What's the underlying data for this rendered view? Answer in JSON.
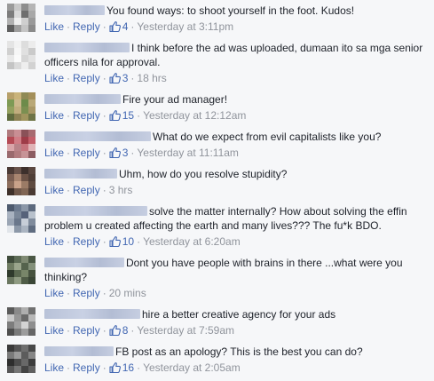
{
  "labels": {
    "like": "Like",
    "reply": "Reply",
    "sep": "·"
  },
  "colors": {
    "link": "#4267b2",
    "meta": "#90949c",
    "text": "#1d2129",
    "background": "#f6f7f9"
  },
  "comments": [
    {
      "text": "You found ways: to shoot yourself in the foot. Kudos!",
      "likes": "4",
      "time": "Yesterday at 3:11pm",
      "avatar": [
        "#9a9a9a",
        "#c8c8c8",
        "#8e8e8e",
        "#b5b5b5",
        "#7c7c7c",
        "#d9d9d9",
        "#6e6e6e",
        "#a8a8a8",
        "#b0b0b0",
        "#eeeeee",
        "#cfcfcf",
        "#999999",
        "#5f5f5f",
        "#9e9e9e",
        "#c4c4c4",
        "#8a8a8a"
      ]
    },
    {
      "text": "I think before the ad was uploaded, dumaan ito sa mga senior officers nila for approval.",
      "likes": "3",
      "time": "18 hrs",
      "avatar": [
        "#e4e4e4",
        "#f2f2f2",
        "#dddddd",
        "#ececec",
        "#d0d0d0",
        "#f6f6f6",
        "#e0e0e0",
        "#cacaca",
        "#e8e8e8",
        "#fafafa",
        "#d6d6d6",
        "#e2e2e2",
        "#c4c4c4",
        "#dadada",
        "#eeeeee",
        "#d2d2d2"
      ]
    },
    {
      "text": "Fire your ad manager!",
      "likes": "15",
      "time": "Yesterday at 12:12am",
      "avatar": [
        "#b7a06a",
        "#c9b37a",
        "#8f8a55",
        "#a38f5a",
        "#7e9a55",
        "#cbb88c",
        "#6d8b4a",
        "#b9a877",
        "#93a05f",
        "#c1ad7e",
        "#7b8f51",
        "#a99766",
        "#5f6b3e",
        "#8d8254",
        "#a0955e",
        "#6f7446"
      ]
    },
    {
      "text": "What do we expect from evil capitalists like you?",
      "likes": "3",
      "time": "Yesterday at 11:11am",
      "avatar": [
        "#b07a7e",
        "#c98e94",
        "#8a5158",
        "#a76a70",
        "#b54a55",
        "#d07d86",
        "#9e3c48",
        "#c45f6a",
        "#d9a5a9",
        "#b98389",
        "#c6747d",
        "#e0b3b6",
        "#9a6a6e",
        "#b27c80",
        "#c79397",
        "#8c5c61"
      ]
    },
    {
      "text": "Uhm, how do you resolve stupidity?",
      "likes": "",
      "time": "3 hrs",
      "avatar": [
        "#4a3a35",
        "#6a544c",
        "#3d302c",
        "#5a4740",
        "#7a5e52",
        "#a88570",
        "#6b5246",
        "#4f3e37",
        "#8c6d5c",
        "#c9a28a",
        "#9b7b66",
        "#5e4a40",
        "#3e302a",
        "#6f574a",
        "#806554",
        "#4a3a33"
      ]
    },
    {
      "text": "solve the matter internally? How about solving the effin problem u created affecting the earth and many lives??? The fu*k BDO.",
      "likes": "10",
      "time": "Yesterday at 6:20am",
      "avatar": [
        "#4d5a6e",
        "#6c7a8f",
        "#8b97a8",
        "#5d6a7e",
        "#a8b2c0",
        "#7a8799",
        "#56627a",
        "#b8c1cc",
        "#9aa5b4",
        "#6a778b",
        "#c7ced8",
        "#7f8b9c",
        "#e1e5ea",
        "#8c98a8",
        "#aab4c1",
        "#5f6c80"
      ]
    },
    {
      "text": "Dont you have people with brains in there ...what were you thinking?",
      "likes": "",
      "time": "20 mins",
      "avatar": [
        "#3e4a3a",
        "#5d6b56",
        "#7f8a73",
        "#4a5744",
        "#6f7c63",
        "#9aa58c",
        "#55634d",
        "#83907a",
        "#2f3a2c",
        "#5a6850",
        "#788669",
        "#46523f",
        "#6a7760",
        "#8f9b82",
        "#4f5c47",
        "#3a4636"
      ]
    },
    {
      "text": "hire a better creative agency for your ads",
      "likes": "8",
      "time": "Yesterday at 7:59am",
      "avatar": [
        "#5a5a5a",
        "#8a8a8a",
        "#aeaeae",
        "#707070",
        "#c9c9c9",
        "#969696",
        "#6a6a6a",
        "#b7b7b7",
        "#7d7d7d",
        "#a1a1a1",
        "#d4d4d4",
        "#8e8e8e",
        "#4e4e4e",
        "#7a7a7a",
        "#9c9c9c",
        "#666666"
      ]
    },
    {
      "text": "FB post as an apology? This is the best you can do?",
      "likes": "16",
      "time": "Yesterday at 2:05am",
      "avatar": [
        "#3a3a3a",
        "#555555",
        "#6e6e6e",
        "#484848",
        "#7a7a7a",
        "#9a9a9a",
        "#5c5c5c",
        "#868686",
        "#2e2e2e",
        "#4c4c4c",
        "#686868",
        "#3c3c3c",
        "#565656",
        "#767676",
        "#444444",
        "#606060"
      ]
    }
  ]
}
